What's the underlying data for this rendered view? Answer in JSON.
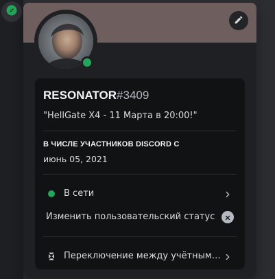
{
  "profile": {
    "username": "RESONATOR",
    "discriminator": "#3409",
    "custom_status": "\"HellGate X4 - 11 Марта в 20:00!\"",
    "member_since_title": "В ЧИСЛЕ УЧАСТНИКОВ DISCORD С",
    "member_since_date": "июнь 05, 2021"
  },
  "menu": {
    "status_label": "В сети",
    "edit_custom_status_label": "Изменить пользовательский статус",
    "switch_accounts_label": "Переключение между учётными ..."
  },
  "colors": {
    "banner": "#6f5e5e",
    "online": "#23a55a",
    "card_bg": "#111214",
    "popout_bg": "#1f2023"
  },
  "icons": {
    "rail": "compass-icon",
    "edit": "pencil-icon",
    "status": "online-status-icon",
    "chevron": "chevron-right-icon",
    "clear": "clear-x-icon",
    "switch_accounts": "switch-accounts-icon"
  }
}
